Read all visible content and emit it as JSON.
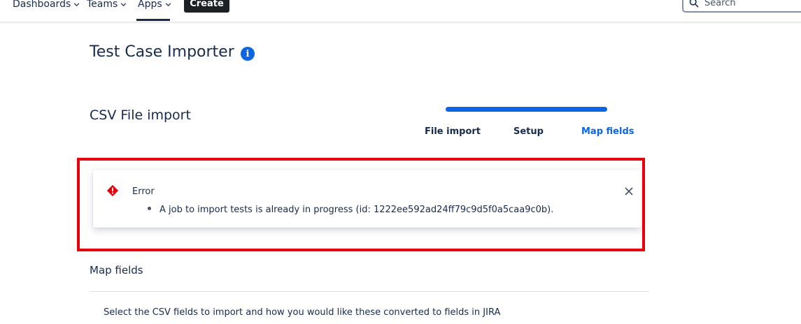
{
  "nav": {
    "items": [
      {
        "label": "Dashboards"
      },
      {
        "label": "Teams"
      },
      {
        "label": "Apps"
      }
    ],
    "create_label": "Create",
    "search_placeholder": "Search"
  },
  "page": {
    "title": "Test Case Importer",
    "info_icon": "i"
  },
  "section": {
    "title": "CSV File import"
  },
  "progress": {
    "fraction_complete": 1.0,
    "steps": [
      {
        "label": "File import"
      },
      {
        "label": "Setup"
      },
      {
        "label": "Map fields",
        "active": true
      }
    ]
  },
  "error_flag": {
    "icon": "error-icon",
    "title": "Error",
    "messages": [
      "A job to import tests is already in progress (id: 1222ee592ad24ff79c9d5f0a5caa9c0b)."
    ],
    "highlight_color": "#e8000b"
  },
  "map_fields": {
    "title": "Map fields",
    "description": "Select the CSV fields to import and how you would like these converted to fields in JIRA"
  },
  "colors": {
    "accent": "#0c66e4",
    "error": "#e8000b",
    "text": "#172b4d"
  }
}
